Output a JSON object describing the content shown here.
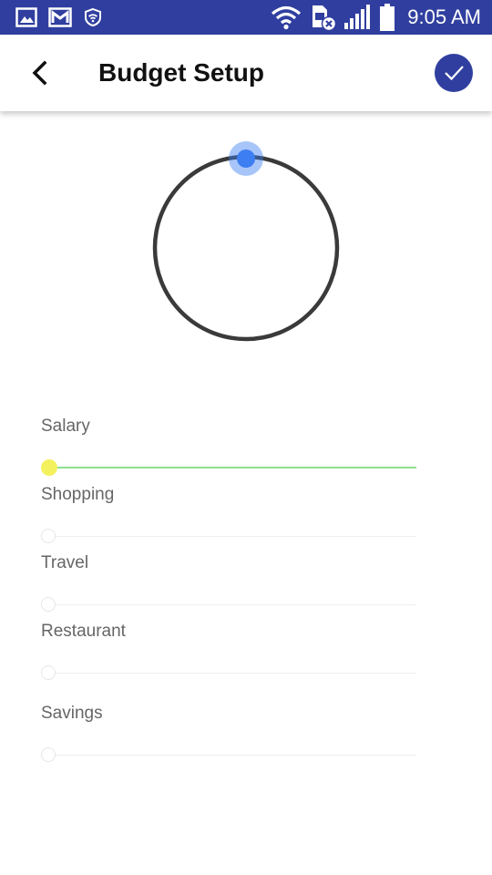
{
  "status_bar": {
    "time": "9:05 AM",
    "background": "#303f9f",
    "icons_left": [
      "image-icon",
      "gmail-icon",
      "shield-wifi-icon"
    ],
    "icons_right": [
      "wifi-icon",
      "sim-error-icon",
      "signal-icon",
      "battery-icon"
    ]
  },
  "app_bar": {
    "title": "Budget Setup",
    "back_icon": "chevron-left-icon",
    "confirm_icon": "check-icon",
    "accent": "#303f9f"
  },
  "dial": {
    "value": 0,
    "ring_color": "#3a3a3a",
    "handle_color": "#3d7ef2"
  },
  "categories": [
    {
      "label": "Salary",
      "value": 0,
      "active": true
    },
    {
      "label": "Shopping",
      "value": 0,
      "active": false
    },
    {
      "label": "Travel",
      "value": 0,
      "active": false
    },
    {
      "label": "Restaurant",
      "value": 0,
      "active": false
    },
    {
      "label": "Savings",
      "value": 0,
      "active": false
    }
  ],
  "colors": {
    "active_track": "#8fe08f",
    "active_thumb": "#f4f15e"
  }
}
